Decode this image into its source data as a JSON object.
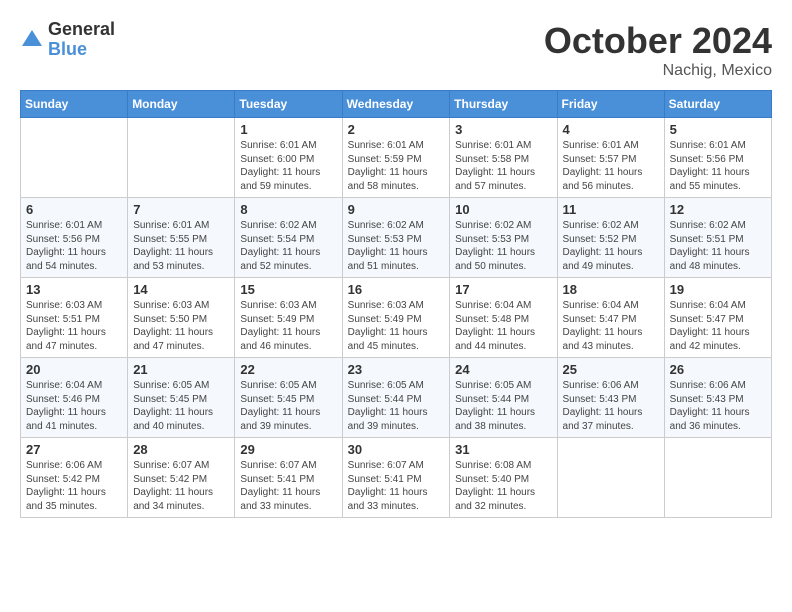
{
  "header": {
    "logo_general": "General",
    "logo_blue": "Blue",
    "month_title": "October 2024",
    "location": "Nachig, Mexico"
  },
  "weekdays": [
    "Sunday",
    "Monday",
    "Tuesday",
    "Wednesday",
    "Thursday",
    "Friday",
    "Saturday"
  ],
  "weeks": [
    [
      {
        "day": "",
        "sunrise": "",
        "sunset": "",
        "daylight": ""
      },
      {
        "day": "",
        "sunrise": "",
        "sunset": "",
        "daylight": ""
      },
      {
        "day": "1",
        "sunrise": "Sunrise: 6:01 AM",
        "sunset": "Sunset: 6:00 PM",
        "daylight": "Daylight: 11 hours and 59 minutes."
      },
      {
        "day": "2",
        "sunrise": "Sunrise: 6:01 AM",
        "sunset": "Sunset: 5:59 PM",
        "daylight": "Daylight: 11 hours and 58 minutes."
      },
      {
        "day": "3",
        "sunrise": "Sunrise: 6:01 AM",
        "sunset": "Sunset: 5:58 PM",
        "daylight": "Daylight: 11 hours and 57 minutes."
      },
      {
        "day": "4",
        "sunrise": "Sunrise: 6:01 AM",
        "sunset": "Sunset: 5:57 PM",
        "daylight": "Daylight: 11 hours and 56 minutes."
      },
      {
        "day": "5",
        "sunrise": "Sunrise: 6:01 AM",
        "sunset": "Sunset: 5:56 PM",
        "daylight": "Daylight: 11 hours and 55 minutes."
      }
    ],
    [
      {
        "day": "6",
        "sunrise": "Sunrise: 6:01 AM",
        "sunset": "Sunset: 5:56 PM",
        "daylight": "Daylight: 11 hours and 54 minutes."
      },
      {
        "day": "7",
        "sunrise": "Sunrise: 6:01 AM",
        "sunset": "Sunset: 5:55 PM",
        "daylight": "Daylight: 11 hours and 53 minutes."
      },
      {
        "day": "8",
        "sunrise": "Sunrise: 6:02 AM",
        "sunset": "Sunset: 5:54 PM",
        "daylight": "Daylight: 11 hours and 52 minutes."
      },
      {
        "day": "9",
        "sunrise": "Sunrise: 6:02 AM",
        "sunset": "Sunset: 5:53 PM",
        "daylight": "Daylight: 11 hours and 51 minutes."
      },
      {
        "day": "10",
        "sunrise": "Sunrise: 6:02 AM",
        "sunset": "Sunset: 5:53 PM",
        "daylight": "Daylight: 11 hours and 50 minutes."
      },
      {
        "day": "11",
        "sunrise": "Sunrise: 6:02 AM",
        "sunset": "Sunset: 5:52 PM",
        "daylight": "Daylight: 11 hours and 49 minutes."
      },
      {
        "day": "12",
        "sunrise": "Sunrise: 6:02 AM",
        "sunset": "Sunset: 5:51 PM",
        "daylight": "Daylight: 11 hours and 48 minutes."
      }
    ],
    [
      {
        "day": "13",
        "sunrise": "Sunrise: 6:03 AM",
        "sunset": "Sunset: 5:51 PM",
        "daylight": "Daylight: 11 hours and 47 minutes."
      },
      {
        "day": "14",
        "sunrise": "Sunrise: 6:03 AM",
        "sunset": "Sunset: 5:50 PM",
        "daylight": "Daylight: 11 hours and 47 minutes."
      },
      {
        "day": "15",
        "sunrise": "Sunrise: 6:03 AM",
        "sunset": "Sunset: 5:49 PM",
        "daylight": "Daylight: 11 hours and 46 minutes."
      },
      {
        "day": "16",
        "sunrise": "Sunrise: 6:03 AM",
        "sunset": "Sunset: 5:49 PM",
        "daylight": "Daylight: 11 hours and 45 minutes."
      },
      {
        "day": "17",
        "sunrise": "Sunrise: 6:04 AM",
        "sunset": "Sunset: 5:48 PM",
        "daylight": "Daylight: 11 hours and 44 minutes."
      },
      {
        "day": "18",
        "sunrise": "Sunrise: 6:04 AM",
        "sunset": "Sunset: 5:47 PM",
        "daylight": "Daylight: 11 hours and 43 minutes."
      },
      {
        "day": "19",
        "sunrise": "Sunrise: 6:04 AM",
        "sunset": "Sunset: 5:47 PM",
        "daylight": "Daylight: 11 hours and 42 minutes."
      }
    ],
    [
      {
        "day": "20",
        "sunrise": "Sunrise: 6:04 AM",
        "sunset": "Sunset: 5:46 PM",
        "daylight": "Daylight: 11 hours and 41 minutes."
      },
      {
        "day": "21",
        "sunrise": "Sunrise: 6:05 AM",
        "sunset": "Sunset: 5:45 PM",
        "daylight": "Daylight: 11 hours and 40 minutes."
      },
      {
        "day": "22",
        "sunrise": "Sunrise: 6:05 AM",
        "sunset": "Sunset: 5:45 PM",
        "daylight": "Daylight: 11 hours and 39 minutes."
      },
      {
        "day": "23",
        "sunrise": "Sunrise: 6:05 AM",
        "sunset": "Sunset: 5:44 PM",
        "daylight": "Daylight: 11 hours and 39 minutes."
      },
      {
        "day": "24",
        "sunrise": "Sunrise: 6:05 AM",
        "sunset": "Sunset: 5:44 PM",
        "daylight": "Daylight: 11 hours and 38 minutes."
      },
      {
        "day": "25",
        "sunrise": "Sunrise: 6:06 AM",
        "sunset": "Sunset: 5:43 PM",
        "daylight": "Daylight: 11 hours and 37 minutes."
      },
      {
        "day": "26",
        "sunrise": "Sunrise: 6:06 AM",
        "sunset": "Sunset: 5:43 PM",
        "daylight": "Daylight: 11 hours and 36 minutes."
      }
    ],
    [
      {
        "day": "27",
        "sunrise": "Sunrise: 6:06 AM",
        "sunset": "Sunset: 5:42 PM",
        "daylight": "Daylight: 11 hours and 35 minutes."
      },
      {
        "day": "28",
        "sunrise": "Sunrise: 6:07 AM",
        "sunset": "Sunset: 5:42 PM",
        "daylight": "Daylight: 11 hours and 34 minutes."
      },
      {
        "day": "29",
        "sunrise": "Sunrise: 6:07 AM",
        "sunset": "Sunset: 5:41 PM",
        "daylight": "Daylight: 11 hours and 33 minutes."
      },
      {
        "day": "30",
        "sunrise": "Sunrise: 6:07 AM",
        "sunset": "Sunset: 5:41 PM",
        "daylight": "Daylight: 11 hours and 33 minutes."
      },
      {
        "day": "31",
        "sunrise": "Sunrise: 6:08 AM",
        "sunset": "Sunset: 5:40 PM",
        "daylight": "Daylight: 11 hours and 32 minutes."
      },
      {
        "day": "",
        "sunrise": "",
        "sunset": "",
        "daylight": ""
      },
      {
        "day": "",
        "sunrise": "",
        "sunset": "",
        "daylight": ""
      }
    ]
  ]
}
